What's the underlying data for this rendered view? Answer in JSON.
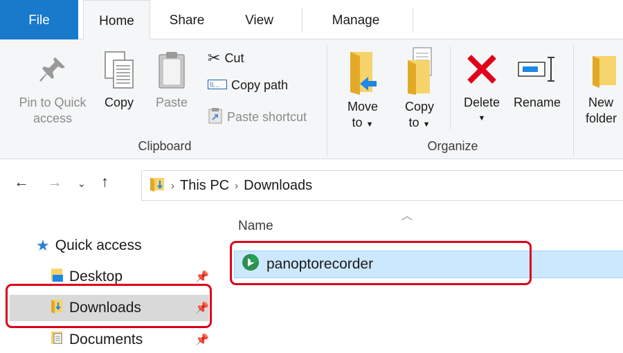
{
  "tabs": [
    {
      "label": "File"
    },
    {
      "label": "Home"
    },
    {
      "label": "Share"
    },
    {
      "label": "View"
    },
    {
      "label": "Manage"
    }
  ],
  "ribbon": {
    "clipboard": {
      "pin_line1": "Pin to Quick",
      "pin_line2": "access",
      "copy": "Copy",
      "paste": "Paste",
      "cut": "Cut",
      "copy_path": "Copy path",
      "paste_shortcut": "Paste shortcut",
      "group_label": "Clipboard"
    },
    "organize": {
      "move_line1": "Move",
      "move_line2": "to",
      "copy_line1": "Copy",
      "copy_line2": "to",
      "delete": "Delete",
      "rename": "Rename",
      "group_label": "Organize"
    },
    "new": {
      "new_line1": "New",
      "new_line2": "folder"
    }
  },
  "address": {
    "crumbs": [
      "This PC",
      "Downloads"
    ]
  },
  "navpane": {
    "quick_access": "Quick access",
    "items": [
      {
        "label": "Desktop"
      },
      {
        "label": "Downloads"
      },
      {
        "label": "Documents"
      }
    ]
  },
  "content": {
    "column_name": "Name",
    "files": [
      {
        "name": "panoptorecorder"
      }
    ]
  },
  "colors": {
    "file_tab": "#1979ca",
    "selection": "#cce8ff",
    "highlight": "#d9001a",
    "delete_x": "#e0001b"
  }
}
